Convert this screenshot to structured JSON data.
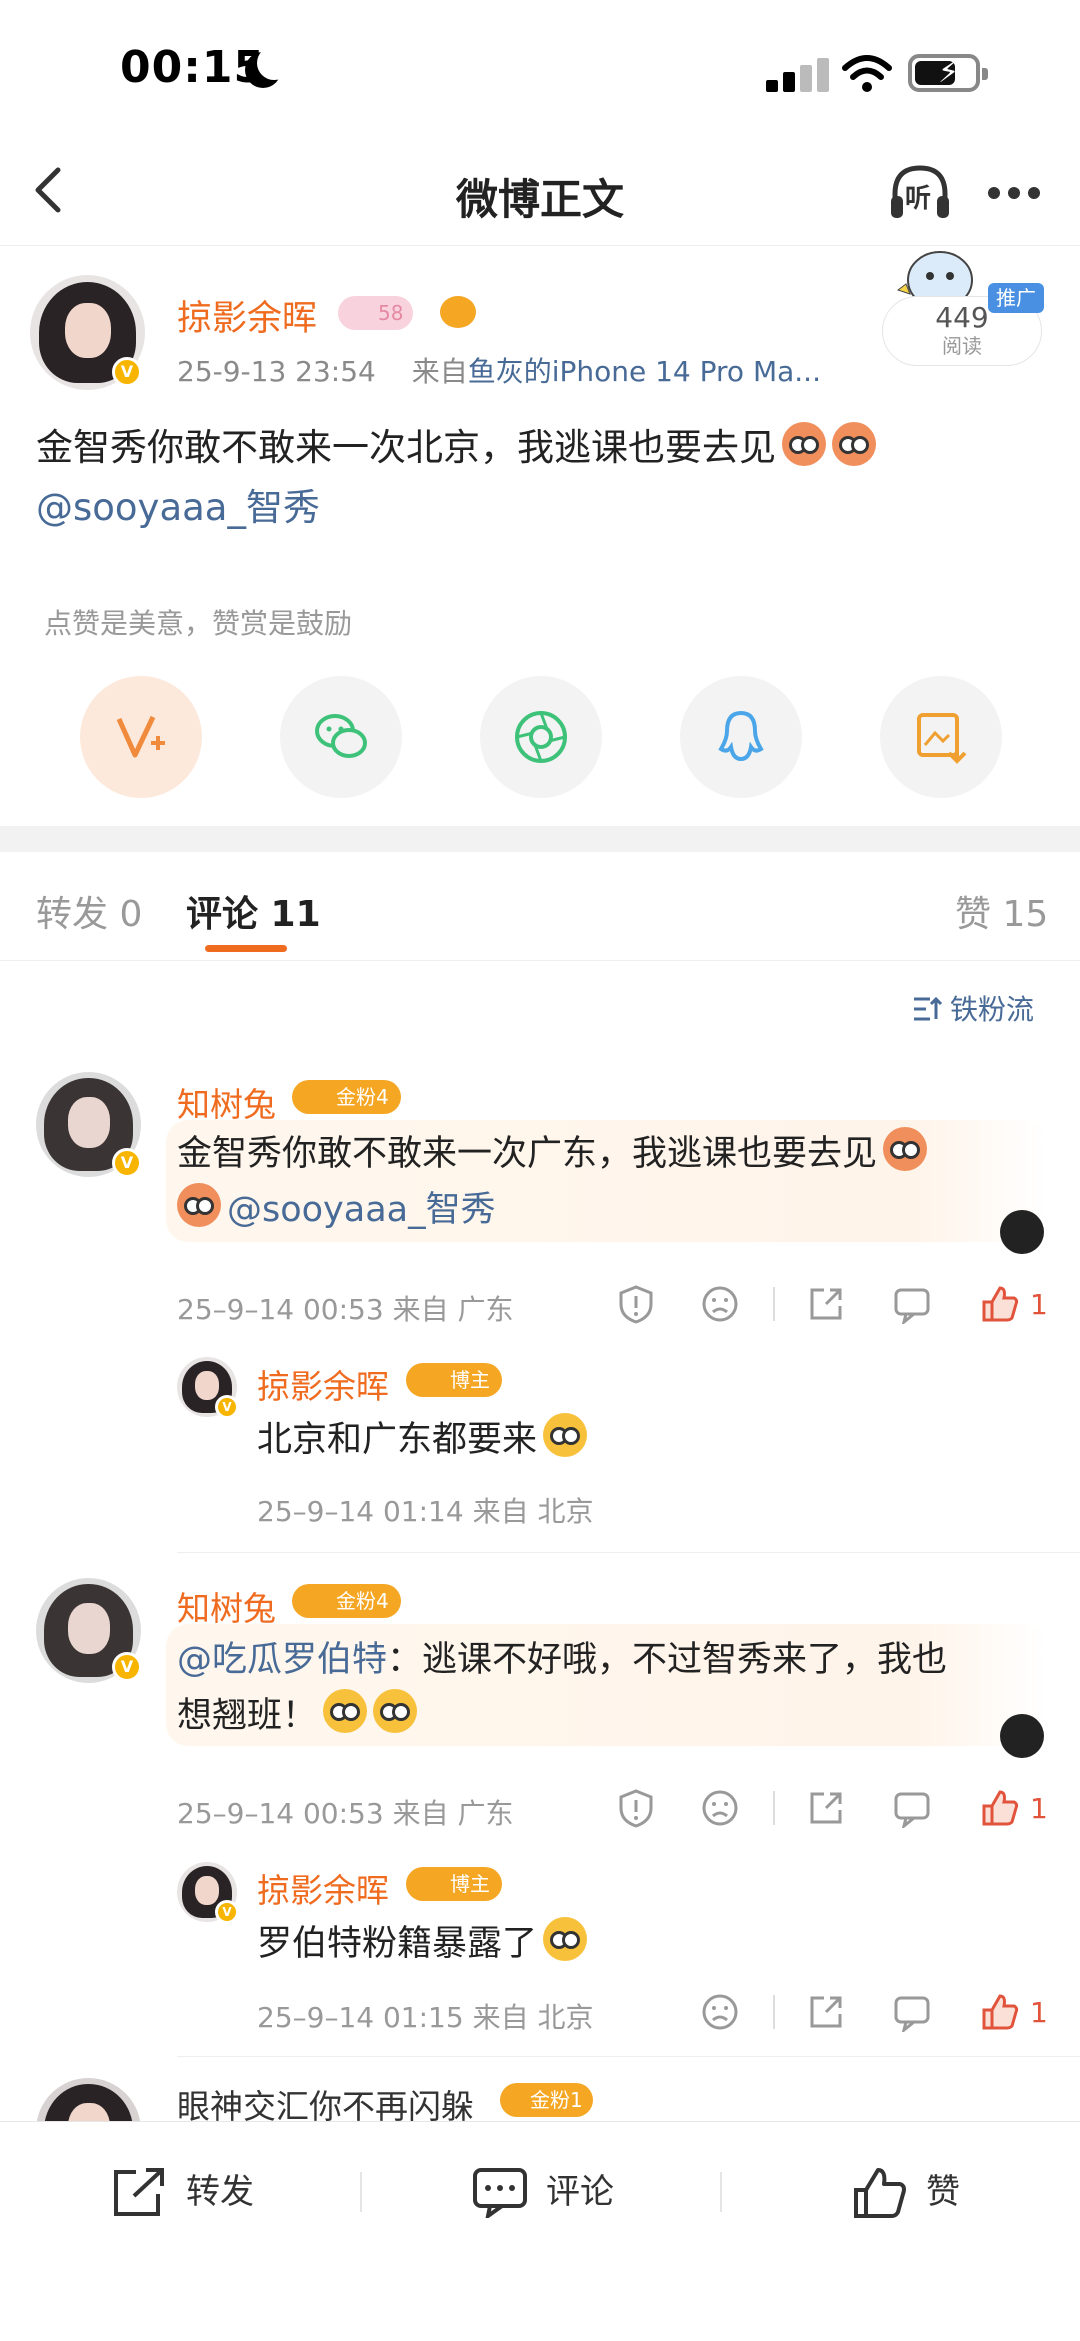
{
  "status": {
    "time": "00:15"
  },
  "nav": {
    "title": "微博正文",
    "listen_label": "听"
  },
  "post": {
    "author": "掠影余晖",
    "level_badge": "58",
    "timestamp": "25-9-13 23:54",
    "source_prefix": "来自",
    "device": "鱼灰的iPhone 14 Pro Ma...",
    "read_count": "449",
    "read_label": "阅读",
    "promo_label": "推广",
    "text": "金智秀你敢不敢来一次北京，我逃课也要去见",
    "mention": "@sooyaaa_智秀",
    "praise_tip": "点赞是美意，赞赏是鼓励"
  },
  "share_buttons": [
    {
      "name": "reward",
      "icon": "v-plus-icon",
      "color": "#f08a3c"
    },
    {
      "name": "wechat",
      "icon": "wechat-icon",
      "color": "#3ec27a"
    },
    {
      "name": "moments",
      "icon": "aperture-icon",
      "color": "#3ec27a"
    },
    {
      "name": "qq",
      "icon": "qq-icon",
      "color": "#4aa6e8"
    },
    {
      "name": "save-image",
      "icon": "image-download-icon",
      "color": "#f0a030"
    }
  ],
  "tabs": {
    "repost": "转发 0",
    "comment": "评论 11",
    "like": "赞 15"
  },
  "sort_label": "铁粉流",
  "comments": [
    {
      "author": "知树兔",
      "fan_badge": "金粉4",
      "text": "金智秀你敢不敢来一次广东，我逃课也要去见",
      "mention": "@sooyaaa_智秀",
      "meta": "25–9–14 00:53  来自 广东",
      "likes": "1",
      "reply": {
        "author": "掠影余晖",
        "role_badge": "博主",
        "text": "北京和广东都要来",
        "meta": "25–9–14 01:14  来自 北京"
      }
    },
    {
      "author": "知树兔",
      "fan_badge": "金粉4",
      "mention": "@吃瓜罗伯特",
      "text_line1": "：逃课不好哦，不过智秀来了，我也",
      "text_line2": "想翘班！",
      "meta": "25–9–14 00:53  来自 广东",
      "likes": "1",
      "reply": {
        "author": "掠影余晖",
        "role_badge": "博主",
        "text": "罗伯特粉籍暴露了",
        "meta": "25–9–14 01:15  来自 北京",
        "likes": "1"
      }
    },
    {
      "author": "眼神交汇你不再闪躲",
      "fan_badge": "金粉1"
    }
  ],
  "bottom_bar": {
    "repost": "转发",
    "comment": "评论",
    "like": "赞"
  },
  "colors": {
    "accent": "#ef6b1f",
    "link": "#486a96",
    "like": "#e2533b"
  }
}
